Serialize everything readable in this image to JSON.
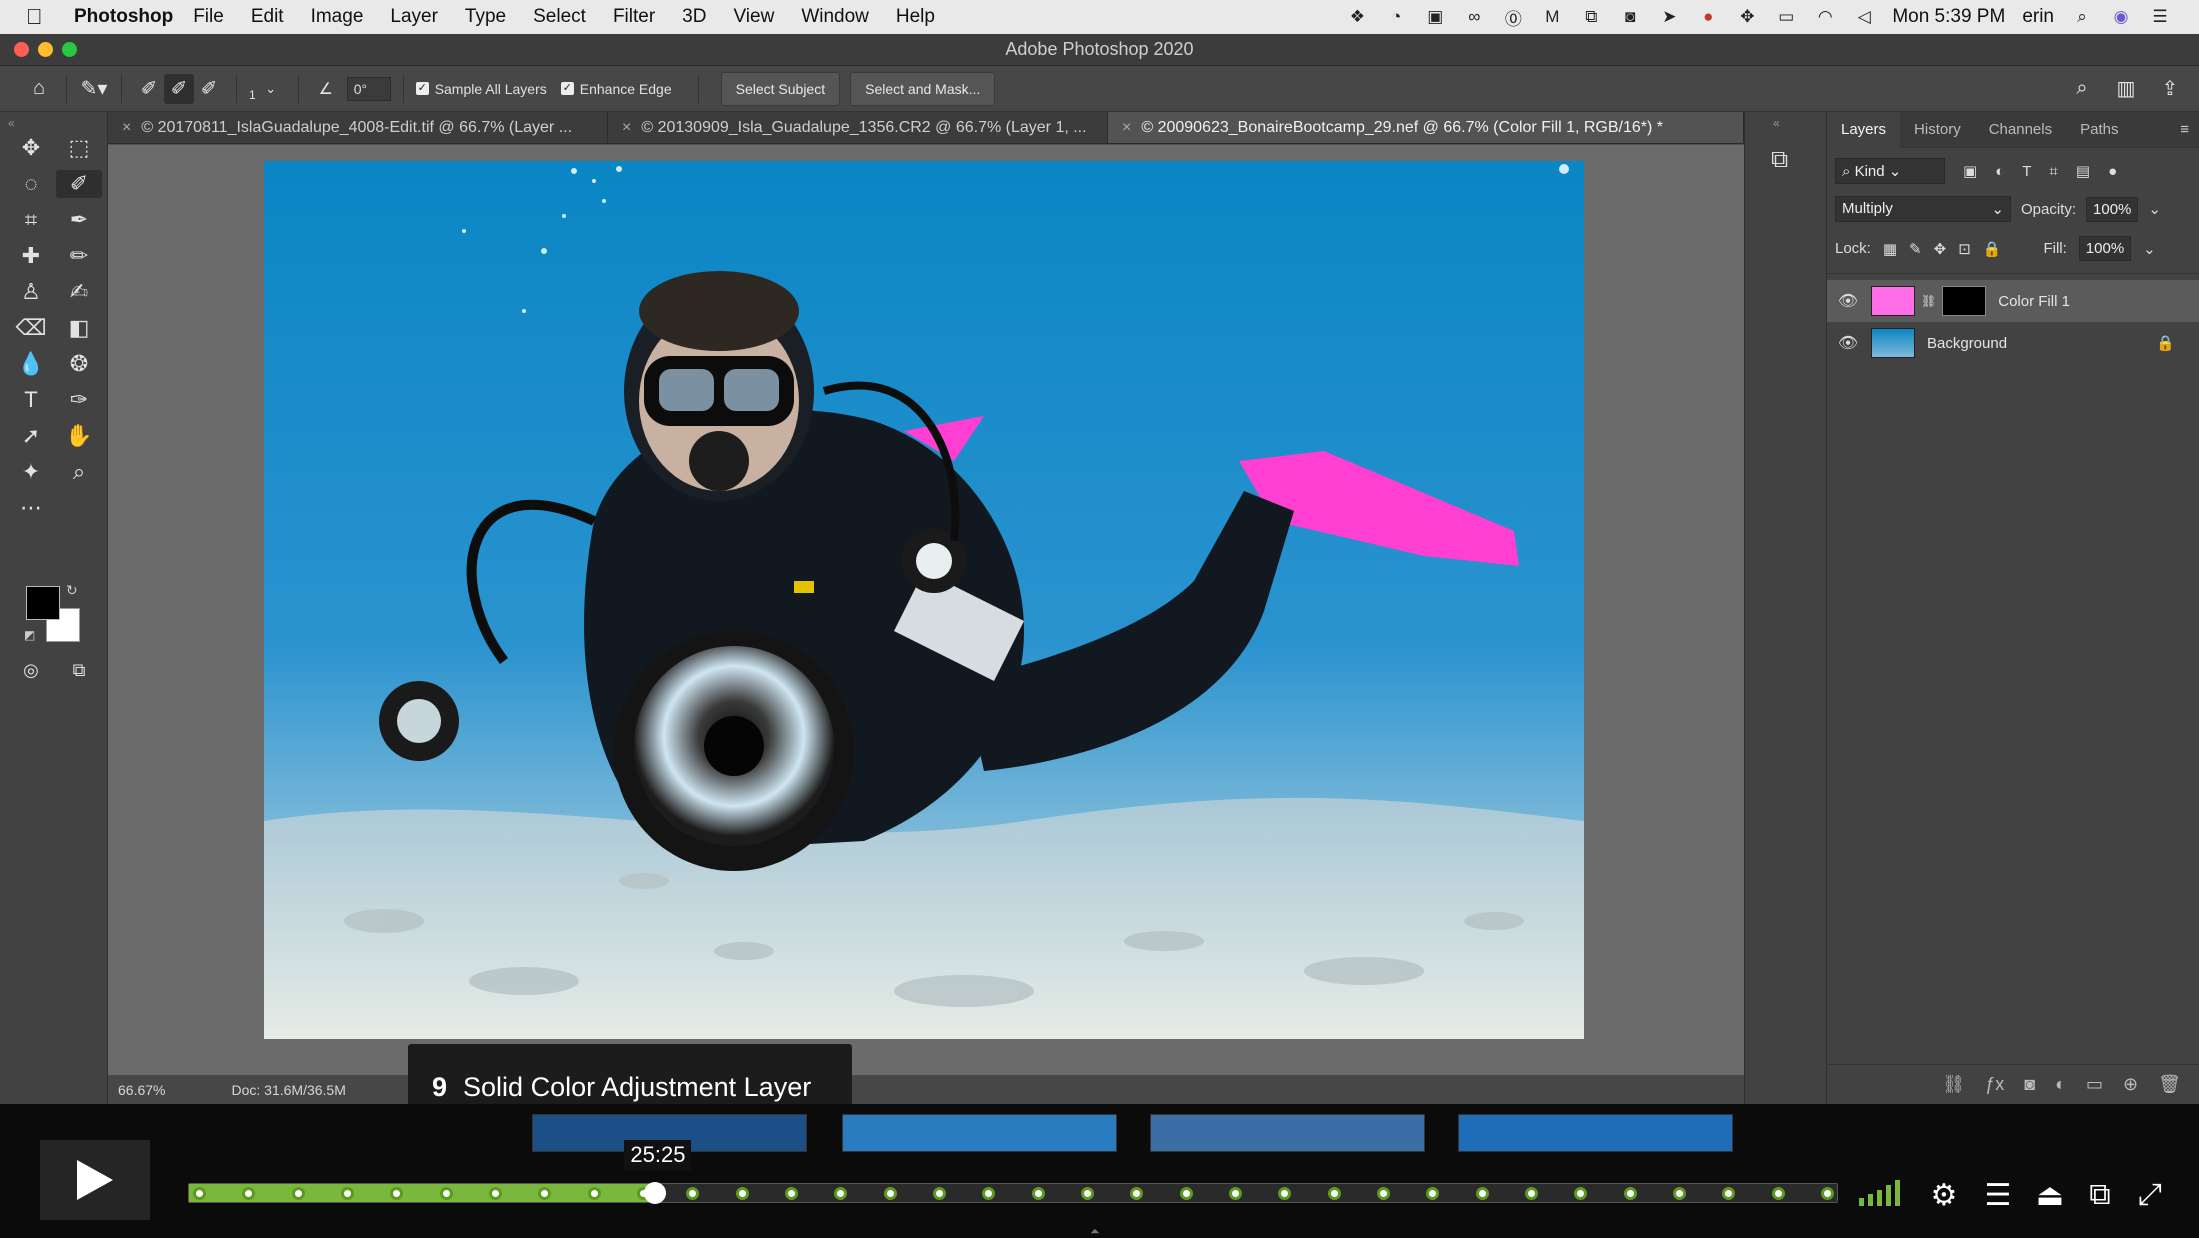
{
  "menubar": {
    "app_name": "Photoshop",
    "items": [
      "File",
      "Edit",
      "Image",
      "Layer",
      "Type",
      "Select",
      "Filter",
      "3D",
      "View",
      "Window",
      "Help"
    ],
    "clock": "Mon 5:39 PM",
    "user": "erin"
  },
  "window": {
    "title": "Adobe Photoshop 2020"
  },
  "options": {
    "angle": "0°",
    "brush_size": "1",
    "sample_all_layers": "Sample All Layers",
    "enhance_edge": "Enhance Edge",
    "select_subject": "Select Subject",
    "select_and_mask": "Select and Mask..."
  },
  "tabs": [
    {
      "label": "© 20170811_IslaGuadalupe_4008-Edit.tif @ 66.7% (Layer ..."
    },
    {
      "label": "© 20130909_Isla_Guadalupe_1356.CR2 @ 66.7% (Layer 1, ..."
    },
    {
      "label": "© 20090623_BonaireBootcamp_29.nef @ 66.7% (Color Fill 1, RGB/16*) *"
    }
  ],
  "statusbar": {
    "zoom": "66.67%",
    "doc": "Doc: 31.6M/36.5M"
  },
  "layers_panel": {
    "tabs": [
      "Layers",
      "History",
      "Channels",
      "Paths"
    ],
    "kind": "Kind",
    "blend_mode": "Multiply",
    "opacity_label": "Opacity:",
    "opacity": "100%",
    "lock_label": "Lock:",
    "fill_label": "Fill:",
    "fill": "100%",
    "layers": [
      {
        "name": "Color Fill 1",
        "selected": true,
        "swatch": "#ff6ee6"
      },
      {
        "name": "Background",
        "selected": false
      }
    ]
  },
  "player": {
    "chapter_number": "9",
    "chapter_title": "Solid Color Adjustment Layer",
    "time": "25:25",
    "progress_percent": 28.3,
    "accent": "#79b73d"
  }
}
